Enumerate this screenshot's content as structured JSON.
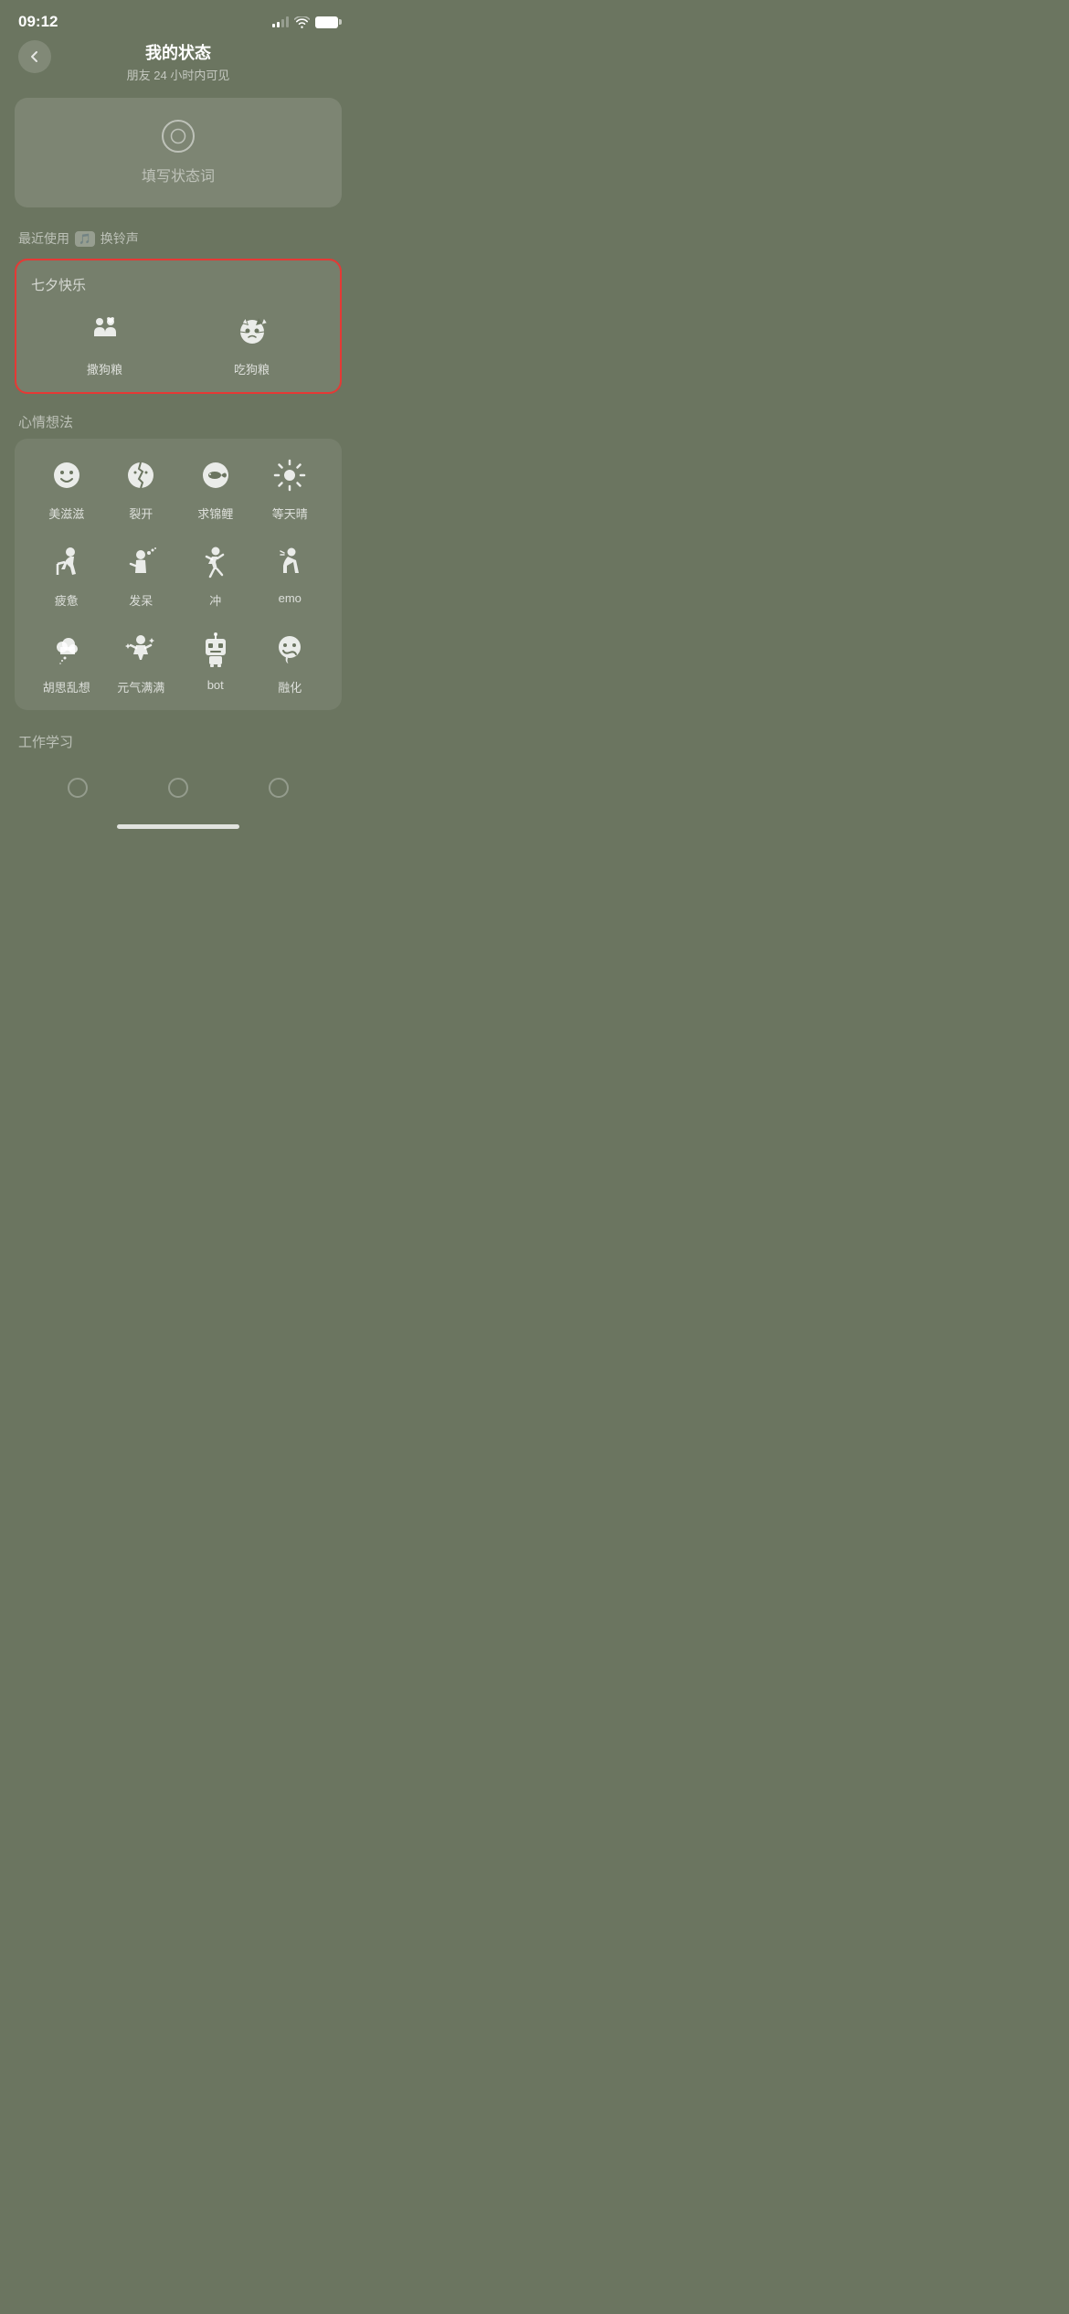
{
  "statusBar": {
    "time": "09:12"
  },
  "header": {
    "title": "我的状态",
    "subtitle": "朋友 24 小时内可见"
  },
  "statusInput": {
    "placeholder": "填写状态词"
  },
  "recentSection": {
    "label": "最近使用",
    "ringtoneLabel": "换铃声"
  },
  "qixiSection": {
    "title": "七夕快乐",
    "items": [
      {
        "label": "撒狗粮",
        "icon": "couple"
      },
      {
        "label": "吃狗粮",
        "icon": "cat-sad"
      }
    ]
  },
  "moodSection": {
    "title": "心情想法",
    "items": [
      {
        "label": "美滋滋",
        "icon": "smile"
      },
      {
        "label": "裂开",
        "icon": "cracked"
      },
      {
        "label": "求锦鲤",
        "icon": "koi"
      },
      {
        "label": "等天晴",
        "icon": "sun"
      },
      {
        "label": "疲惫",
        "icon": "tired"
      },
      {
        "label": "发呆",
        "icon": "daze"
      },
      {
        "label": "冲",
        "icon": "rush"
      },
      {
        "label": "emo",
        "icon": "emo"
      },
      {
        "label": "胡思乱想",
        "icon": "thought"
      },
      {
        "label": "元气满满",
        "icon": "energetic"
      },
      {
        "label": "bot",
        "icon": "bot"
      },
      {
        "label": "融化",
        "icon": "melt"
      }
    ]
  },
  "workSection": {
    "title": "工作学习"
  }
}
